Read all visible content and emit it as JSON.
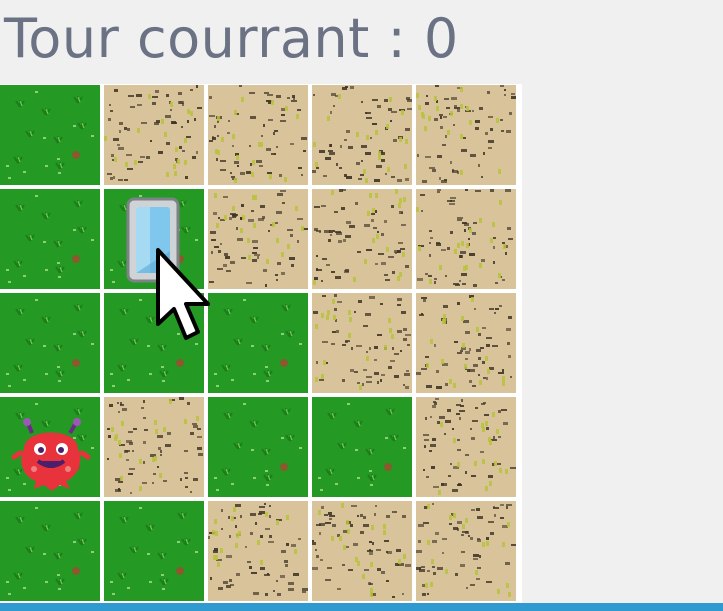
{
  "header": {
    "title": "Tour courrant : 0"
  },
  "colors": {
    "window_bg": "#f0f0f0",
    "title_text": "#6b7284",
    "grass": "#249a24",
    "grass_dark": "#1c7d1c",
    "dirt": "#d9c39a",
    "dirt_dark": "#3c3223",
    "grid_line": "#ffffff",
    "accent_strip": "#2e9ad0",
    "monster": "#e8323c"
  },
  "board": {
    "rows": 5,
    "cols": 5,
    "grid": [
      [
        "grass",
        "dirt",
        "dirt",
        "dirt",
        "dirt"
      ],
      [
        "grass",
        "grass",
        "dirt",
        "dirt",
        "dirt"
      ],
      [
        "grass",
        "grass",
        "grass",
        "dirt",
        "dirt"
      ],
      [
        "grass",
        "dirt",
        "grass",
        "grass",
        "dirt"
      ],
      [
        "grass",
        "grass",
        "dirt",
        "dirt",
        "dirt"
      ]
    ],
    "pieces": [
      {
        "type": "exit-door",
        "row": 1,
        "col": 1,
        "icon": "door-icon"
      },
      {
        "type": "red-monster",
        "row": 3,
        "col": 0,
        "icon": "monster-icon"
      }
    ]
  },
  "cursor": {
    "icon": "mouse-pointer-icon"
  }
}
